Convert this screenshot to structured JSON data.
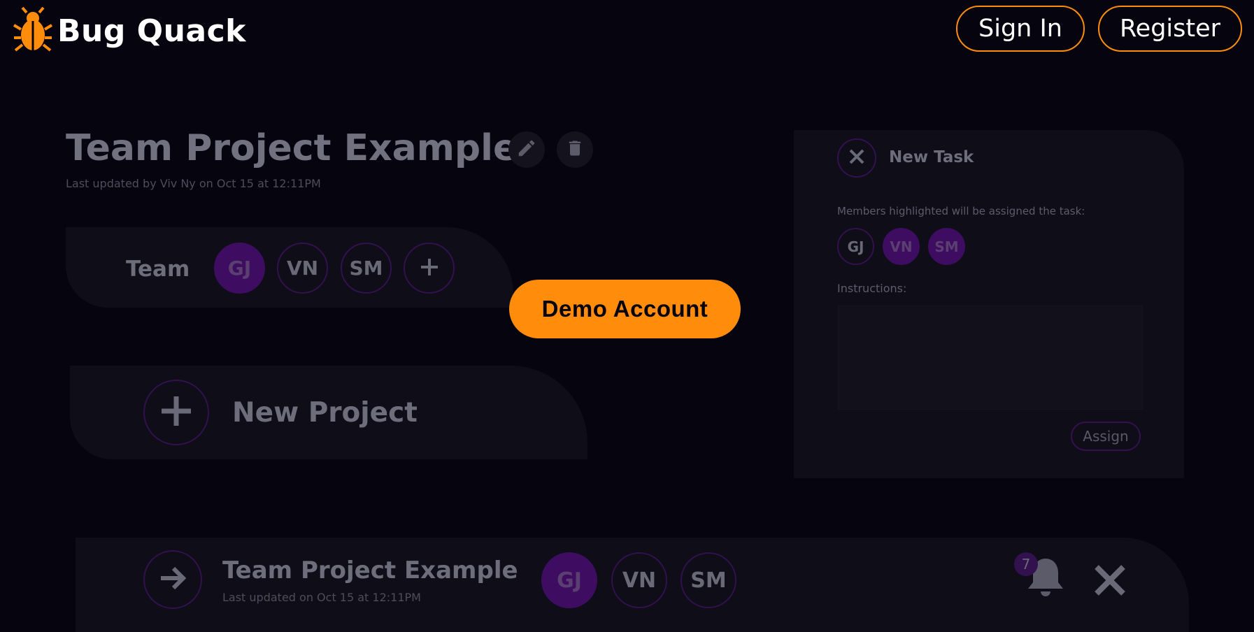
{
  "header": {
    "app_name": "Bug Quack",
    "sign_in_label": "Sign In",
    "register_label": "Register"
  },
  "demo_button_label": "Demo Account",
  "project_detail": {
    "title": "Team Project Example",
    "last_updated": "Last updated by Viv Ny on Oct 15 at 12:11PM",
    "team_label": "Team",
    "members": [
      "GJ",
      "VN",
      "SM"
    ],
    "add_icon": "plus-icon"
  },
  "new_project": {
    "label": "New Project"
  },
  "new_task_panel": {
    "title": "New Task",
    "members_hint": "Members highlighted will be assigned the task:",
    "members": [
      "GJ",
      "VN",
      "SM"
    ],
    "instructions_label": "Instructions:",
    "assign_label": "Assign"
  },
  "project_row": {
    "title": "Team Project Example",
    "last_updated": "Last updated on Oct 15 at 12:11PM",
    "members": [
      "GJ",
      "VN",
      "SM"
    ],
    "notification_count": "7"
  },
  "colors": {
    "accent": "#ff8c0a",
    "purple": "#3e0d62",
    "background": "#05040f"
  }
}
